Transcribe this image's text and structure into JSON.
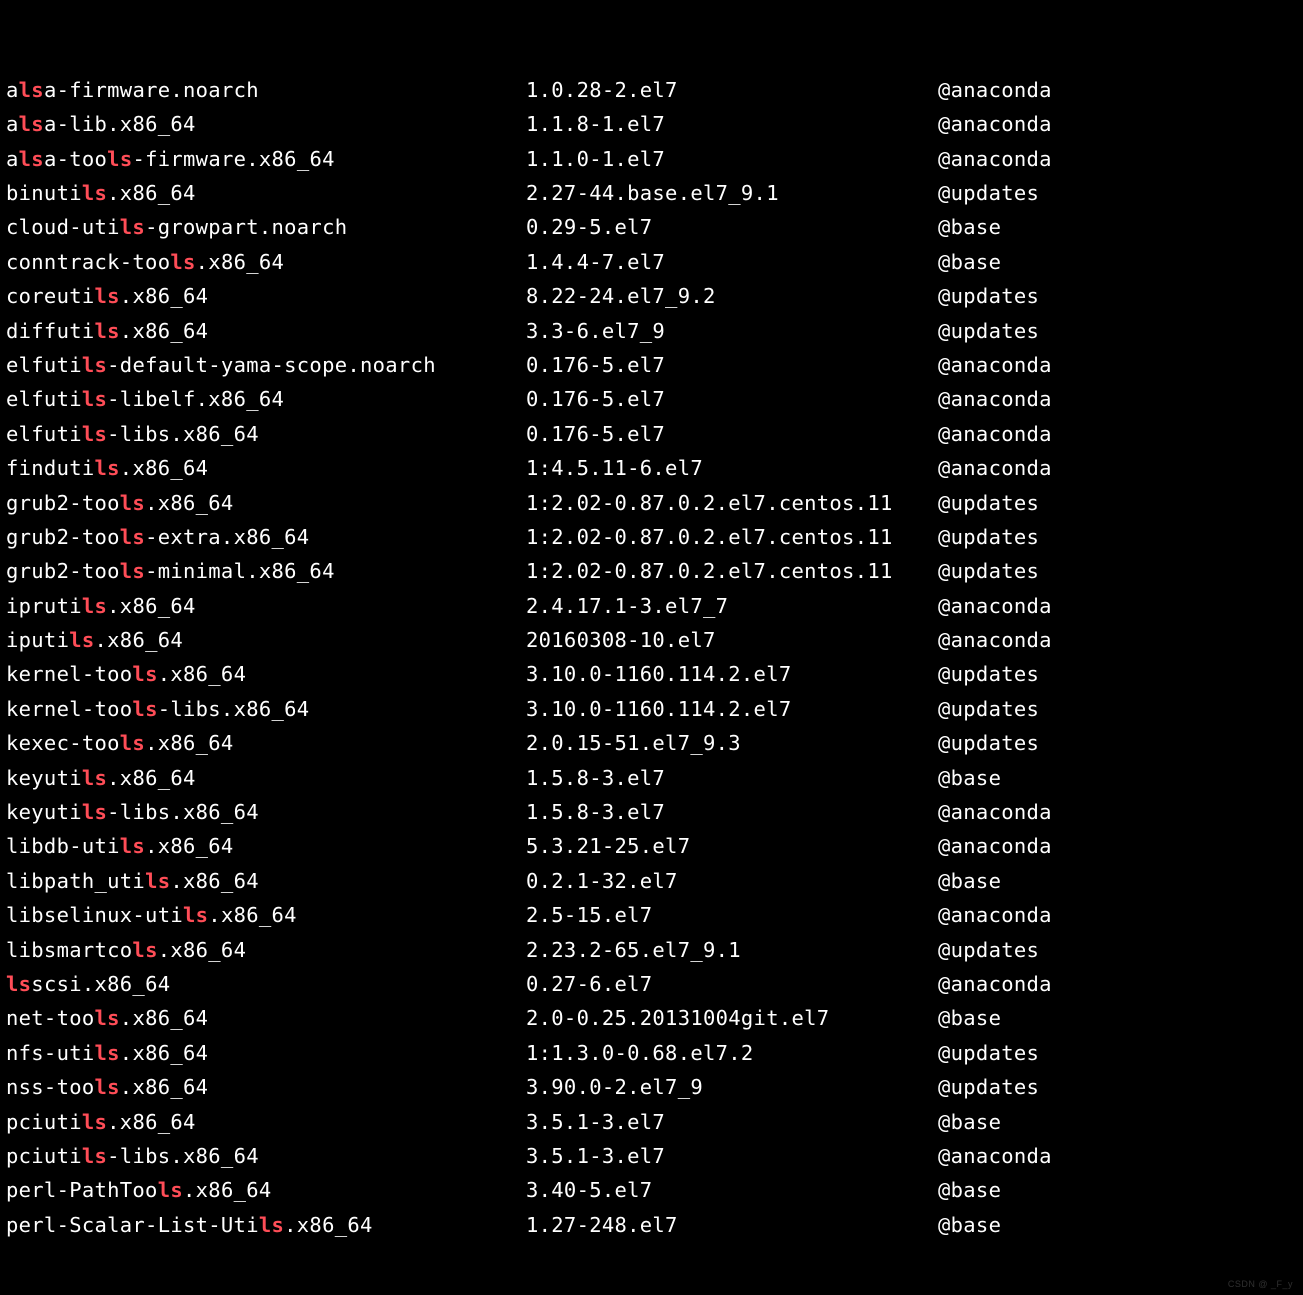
{
  "highlight_pattern": "ls",
  "watermark": "CSDN @ _F_y",
  "packages": [
    {
      "name": "alsa-firmware.noarch",
      "version": "0.28-2.el7",
      "version_prefix": "1.",
      "repo": "@anaconda"
    },
    {
      "name": "alsa-lib.x86_64",
      "version": "1.8-1.el7",
      "version_prefix": "1.",
      "repo": "@anaconda"
    },
    {
      "name": "alsa-tools-firmware.x86_64",
      "version": "1.0-1.el7",
      "version_prefix": "1.",
      "repo": "@anaconda"
    },
    {
      "name": "binutils.x86_64",
      "version": "2.27-44.base.el7_9.1",
      "version_prefix": "",
      "repo": "@updates"
    },
    {
      "name": "cloud-utils-growpart.noarch",
      "version": "0.29-5.el7",
      "version_prefix": "",
      "repo": "@base"
    },
    {
      "name": "conntrack-tools.x86_64",
      "version": "4.4-7.el7",
      "version_prefix": "1.",
      "repo": "@base"
    },
    {
      "name": "coreutils.x86_64",
      "version": "8.22-24.el7_9.2",
      "version_prefix": "",
      "repo": "@updates"
    },
    {
      "name": "diffutils.x86_64",
      "version": "3.3-6.el7_9",
      "version_prefix": "",
      "repo": "@updates"
    },
    {
      "name": "elfutils-default-yama-scope.noarch",
      "version": "0.176-5.el7",
      "version_prefix": "",
      "repo": "@anaconda"
    },
    {
      "name": "elfutils-libelf.x86_64",
      "version": "0.176-5.el7",
      "version_prefix": "",
      "repo": "@anaconda"
    },
    {
      "name": "elfutils-libs.x86_64",
      "version": "0.176-5.el7",
      "version_prefix": "",
      "repo": "@anaconda"
    },
    {
      "name": "findutils.x86_64",
      "version": "4.5.11-6.el7",
      "version_prefix": "1:",
      "repo": "@anaconda"
    },
    {
      "name": "grub2-tools.x86_64",
      "version": "2.02-0.87.0.2.el7.centos.11",
      "version_prefix": "1:",
      "repo": "@updates"
    },
    {
      "name": "grub2-tools-extra.x86_64",
      "version": "2.02-0.87.0.2.el7.centos.11",
      "version_prefix": "1:",
      "repo": "@updates"
    },
    {
      "name": "grub2-tools-minimal.x86_64",
      "version": "2.02-0.87.0.2.el7.centos.11",
      "version_prefix": "1:",
      "repo": "@updates"
    },
    {
      "name": "iprutils.x86_64",
      "version": "2.4.17.1-3.el7_7",
      "version_prefix": "",
      "repo": "@anaconda"
    },
    {
      "name": "iputils.x86_64",
      "version": "20160308-10.el7",
      "version_prefix": "",
      "repo": "@anaconda"
    },
    {
      "name": "kernel-tools.x86_64",
      "version": "3.10.0-1160.114.2.el7",
      "version_prefix": "",
      "repo": "@updates"
    },
    {
      "name": "kernel-tools-libs.x86_64",
      "version": "3.10.0-1160.114.2.el7",
      "version_prefix": "",
      "repo": "@updates"
    },
    {
      "name": "kexec-tools.x86_64",
      "version": "2.0.15-51.el7_9.3",
      "version_prefix": "",
      "repo": "@updates"
    },
    {
      "name": "keyutils.x86_64",
      "version": "5.8-3.el7",
      "version_prefix": "1.",
      "repo": "@base"
    },
    {
      "name": "keyutils-libs.x86_64",
      "version": "5.8-3.el7",
      "version_prefix": "1.",
      "repo": "@anaconda"
    },
    {
      "name": "libdb-utils.x86_64",
      "version": "5.3.21-25.el7",
      "version_prefix": "",
      "repo": "@anaconda"
    },
    {
      "name": "libpath_utils.x86_64",
      "version": "0.2.1-32.el7",
      "version_prefix": "",
      "repo": "@base"
    },
    {
      "name": "libselinux-utils.x86_64",
      "version": "2.5-15.el7",
      "version_prefix": "",
      "repo": "@anaconda"
    },
    {
      "name": "libsmartcols.x86_64",
      "version": "2.23.2-65.el7_9.1",
      "version_prefix": "",
      "repo": "@updates"
    },
    {
      "name": "lsscsi.x86_64",
      "version": "0.27-6.el7",
      "version_prefix": "",
      "repo": "@anaconda"
    },
    {
      "name": "net-tools.x86_64",
      "version": "2.0-0.25.20131004git.el7",
      "version_prefix": "",
      "repo": "@base"
    },
    {
      "name": "nfs-utils.x86_64",
      "version": "1.3.0-0.68.el7.2",
      "version_prefix": "1:",
      "repo": "@updates"
    },
    {
      "name": "nss-tools.x86_64",
      "version": "3.90.0-2.el7_9",
      "version_prefix": "",
      "repo": "@updates"
    },
    {
      "name": "pciutils.x86_64",
      "version": "3.5.1-3.el7",
      "version_prefix": "",
      "repo": "@base"
    },
    {
      "name": "pciutils-libs.x86_64",
      "version": "3.5.1-3.el7",
      "version_prefix": "",
      "repo": "@anaconda"
    },
    {
      "name": "perl-PathTools.x86_64",
      "version": "3.40-5.el7",
      "version_prefix": "",
      "repo": "@base"
    },
    {
      "name": "perl-Scalar-List-Utils.x86_64",
      "version": "27-248.el7",
      "version_prefix": "1.",
      "repo": "@base"
    }
  ]
}
